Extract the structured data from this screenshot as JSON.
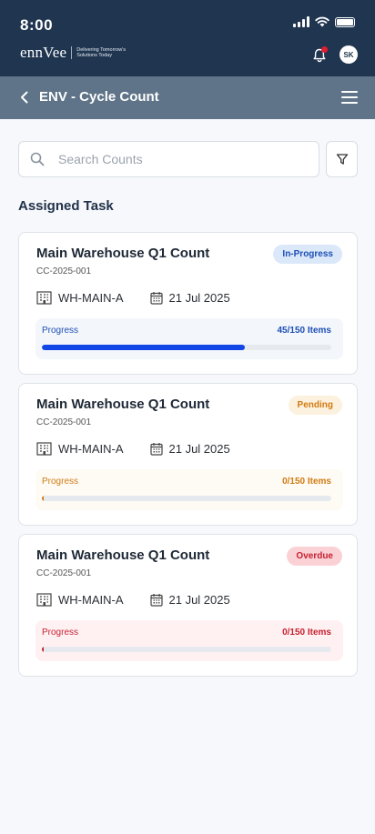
{
  "status_bar": {
    "time": "8:00"
  },
  "brand": {
    "name": "ennVee",
    "tagline": "Delivering Tomorrow's Solutions Today"
  },
  "header": {
    "avatar_initials": "SK"
  },
  "page": {
    "title": "ENV - Cycle Count"
  },
  "search": {
    "placeholder": "Search Counts",
    "value": ""
  },
  "section": {
    "title": "Assigned Task"
  },
  "tasks": [
    {
      "title": "Main Warehouse Q1 Count",
      "code": "CC-2025-001",
      "status": "In-Progress",
      "warehouse": "WH-MAIN-A",
      "date": "21 Jul 2025",
      "progress_label": "Progress",
      "progress_text": "45/150 Items",
      "progress_fraction": 0.7
    },
    {
      "title": "Main Warehouse Q1 Count",
      "code": "CC-2025-001",
      "status": "Pending",
      "warehouse": "WH-MAIN-A",
      "date": "21 Jul 2025",
      "progress_label": "Progress",
      "progress_text": "0/150 Items",
      "progress_fraction": 0.005
    },
    {
      "title": "Main Warehouse Q1 Count",
      "code": "CC-2025-001",
      "status": "Overdue",
      "warehouse": "WH-MAIN-A",
      "date": "21 Jul 2025",
      "progress_label": "Progress",
      "progress_text": "0/150 Items",
      "progress_fraction": 0.005
    }
  ],
  "colors": {
    "header_bg": "#1f3550",
    "titlebar_bg": "#5f7489",
    "in_progress": "#1147e6",
    "pending": "#d27a12",
    "overdue": "#c62131"
  }
}
